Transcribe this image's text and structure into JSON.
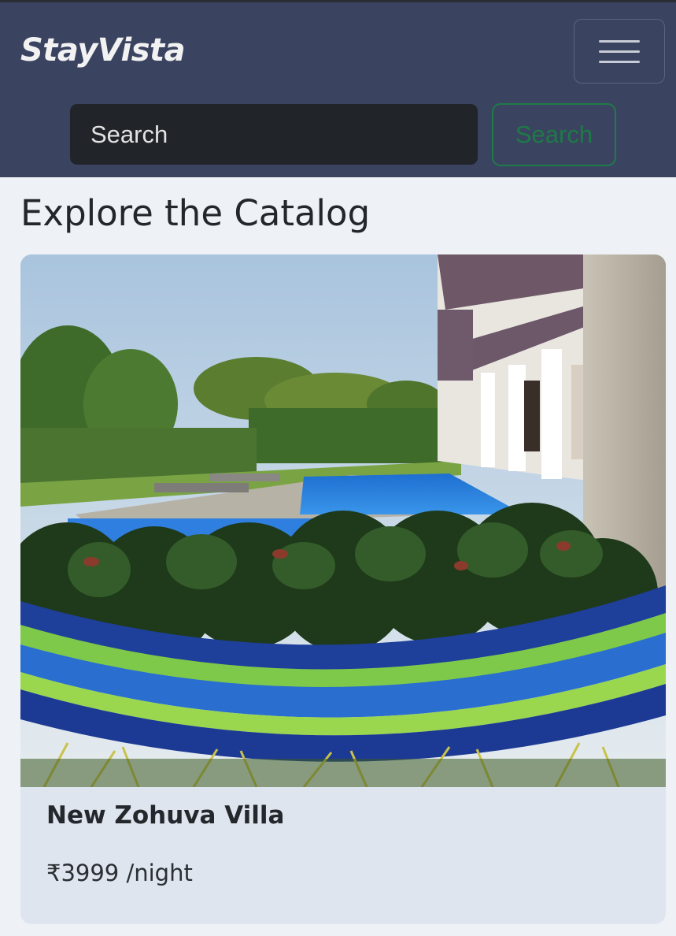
{
  "navbar": {
    "brand": "StayVista",
    "menu_icon": "hamburger-menu-icon",
    "search_placeholder": "Search",
    "search_button_label": "Search"
  },
  "main": {
    "title": "Explore the Catalog",
    "listings": [
      {
        "name": "New Zohuva Villa",
        "price": "₹3999 /night"
      }
    ]
  }
}
